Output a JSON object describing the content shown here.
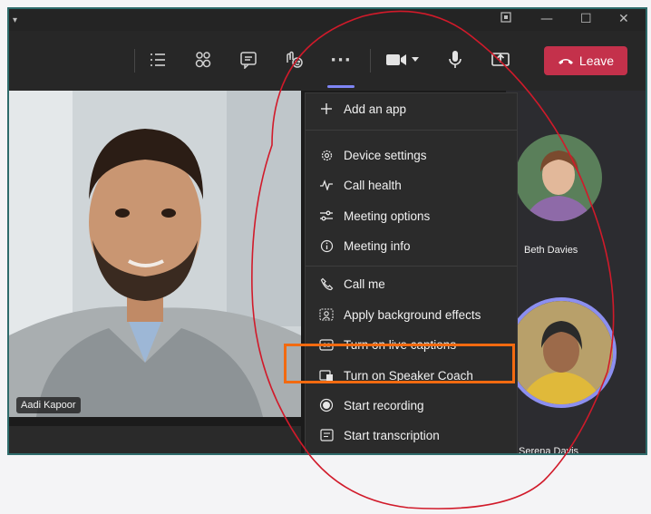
{
  "window": {
    "controls": {
      "minimize": "—",
      "maximize": "☐",
      "close": "✕"
    }
  },
  "toolbar": {
    "icons": [
      "list-icon",
      "people-icon",
      "chat-icon",
      "reactions-icon",
      "more-icon",
      "camera-icon",
      "mic-icon",
      "share-icon"
    ],
    "more_label": "···",
    "leave_label": "Leave",
    "leave_color": "#c4314b"
  },
  "menu": {
    "items": [
      {
        "label": "Add an app",
        "icon": "plus-icon"
      },
      {
        "label": "Device settings",
        "icon": "gear-icon"
      },
      {
        "label": "Call health",
        "icon": "pulse-icon"
      },
      {
        "label": "Meeting options",
        "icon": "sliders-icon"
      },
      {
        "label": "Meeting info",
        "icon": "info-icon"
      },
      {
        "label": "Call me",
        "icon": "phone-icon"
      },
      {
        "label": "Apply background effects",
        "icon": "background-icon"
      },
      {
        "label": "Turn on live captions",
        "icon": "cc-icon"
      },
      {
        "label": "Turn on Speaker Coach",
        "icon": "speaker-coach-icon"
      },
      {
        "label": "Start recording",
        "icon": "record-icon"
      },
      {
        "label": "Start transcription",
        "icon": "transcript-icon"
      }
    ],
    "highlight_color": "#f26a10"
  },
  "participants": {
    "main": "Aadi Kapoor",
    "beth": "Beth Davies",
    "serena": "Serena Davis"
  },
  "annotation": {
    "circle_color": "#d11a2a"
  }
}
